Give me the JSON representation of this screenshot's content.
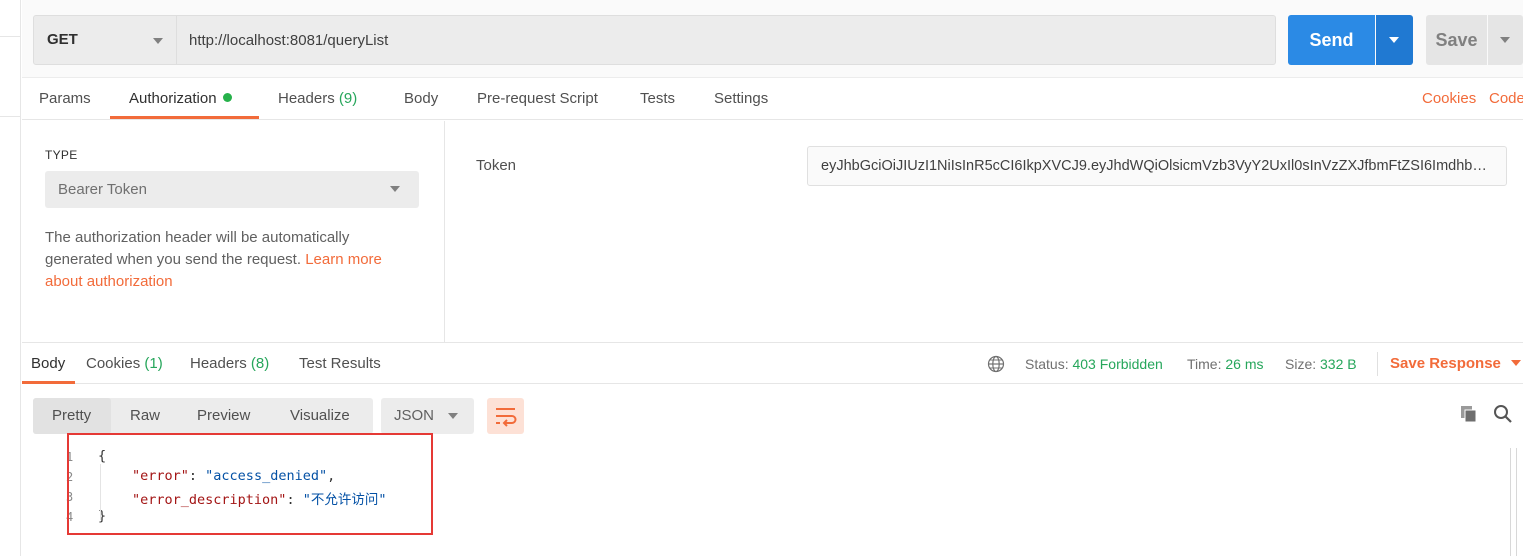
{
  "request": {
    "method": "GET",
    "url": "http://localhost:8081/queryList",
    "send_label": "Send",
    "save_label": "Save"
  },
  "request_tabs": [
    {
      "label": "Params",
      "count": ""
    },
    {
      "label": "Authorization",
      "count": ""
    },
    {
      "label": "Headers",
      "count": "(9)"
    },
    {
      "label": "Body",
      "count": ""
    },
    {
      "label": "Pre-request Script",
      "count": ""
    },
    {
      "label": "Tests",
      "count": ""
    },
    {
      "label": "Settings",
      "count": ""
    }
  ],
  "request_links": {
    "cookies": "Cookies",
    "code": "Code"
  },
  "auth": {
    "type_label": "TYPE",
    "type_value": "Bearer Token",
    "help_text": "The authorization header will be automatically generated when you send the request. ",
    "help_link": "Learn more about authorization",
    "token_label": "Token",
    "token_value": "eyJhbGciOiJIUzI1NiIsInR5cCI6IkpXVCJ9.eyJhdWQiOlsicmVzb3VyY2UxIl0sInVzZXJfbmFtZSI6Imdhb…"
  },
  "response_tabs": [
    {
      "label": "Body",
      "count": ""
    },
    {
      "label": "Cookies",
      "count": "(1)"
    },
    {
      "label": "Headers",
      "count": "(8)"
    },
    {
      "label": "Test Results",
      "count": ""
    }
  ],
  "response_status": {
    "status_label": "Status:",
    "status_value": "403 Forbidden",
    "time_label": "Time:",
    "time_value": "26 ms",
    "size_label": "Size:",
    "size_value": "332 B",
    "save_response": "Save Response"
  },
  "view_tabs": [
    "Pretty",
    "Raw",
    "Preview",
    "Visualize"
  ],
  "format": "JSON",
  "code_lines": [
    {
      "num": "1",
      "text": "{"
    },
    {
      "num": "2",
      "key": "\"error\"",
      "sep": ": ",
      "value": "\"access_denied\"",
      "tail": ","
    },
    {
      "num": "3",
      "key": "\"error_description\"",
      "sep": ": ",
      "value": "\"不允许访问\"",
      "tail": ""
    },
    {
      "num": "4",
      "text": "}"
    }
  ],
  "colors": {
    "accent": "#f26b3a",
    "primary": "#2b8ae5",
    "success": "#26a65b",
    "highlight_box": "#e53935"
  }
}
